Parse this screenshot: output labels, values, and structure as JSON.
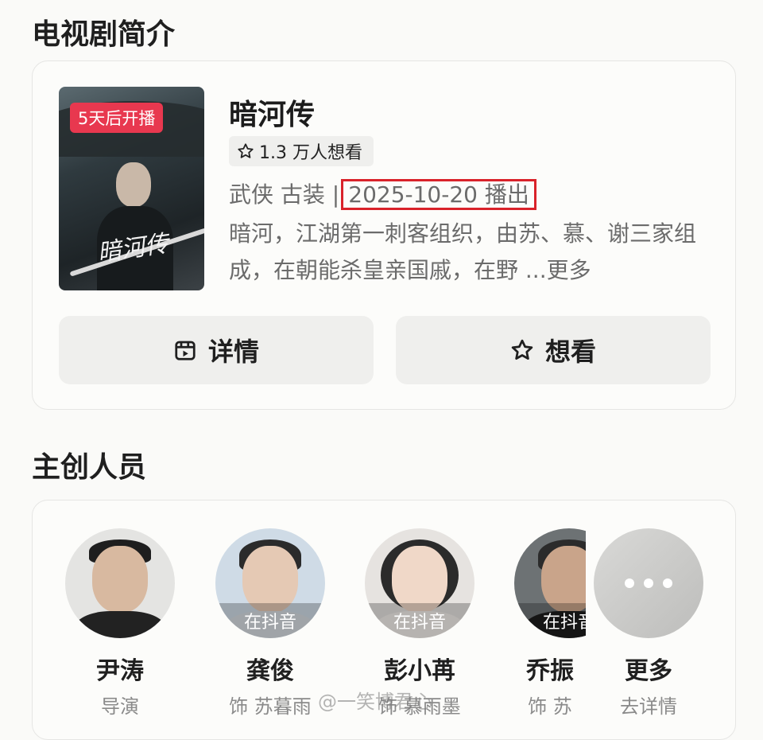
{
  "sections": {
    "intro_title": "电视剧简介",
    "cast_title": "主创人员"
  },
  "show": {
    "badge": "5天后开播",
    "poster_text": "暗河传",
    "title": "暗河传",
    "want_count": "1.3 万人想看",
    "genre": "武侠 古装 |",
    "air_date": "2025-10-20 播出",
    "description": "暗河，江湖第一刺客组织，由苏、慕、谢三家组成，在朝能杀皇亲国戚，在野 ",
    "more": "...更多"
  },
  "actions": {
    "detail_label": "详情",
    "want_label": "想看"
  },
  "cast": [
    {
      "name": "尹涛",
      "role": "导演",
      "overlay": ""
    },
    {
      "name": "龚俊",
      "role": "饰 苏暮雨",
      "overlay": "在抖音"
    },
    {
      "name": "彭小苒",
      "role": "饰 慕雨墨",
      "overlay": "在抖音"
    },
    {
      "name": "乔振",
      "role": "饰 苏",
      "overlay": "在抖音"
    },
    {
      "name": "更多",
      "role": "去详情"
    }
  ],
  "watermark": "@一笑博君心",
  "colors": {
    "badge": "#e8384f",
    "highlight_box": "#d9222a",
    "button_bg": "#efefed"
  }
}
